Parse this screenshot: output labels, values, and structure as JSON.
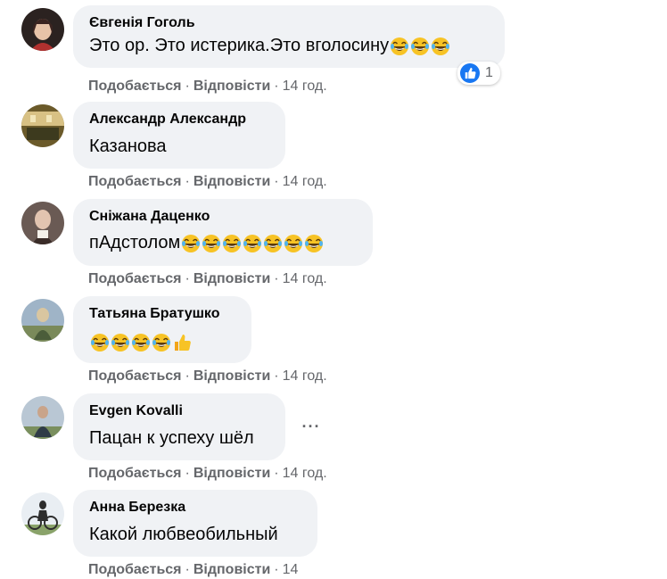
{
  "comments": [
    {
      "author": "Євгенія Гоголь",
      "text": "Это ор. Это истерика.Это вголосину",
      "emojis": [
        "laugh-cry",
        "laugh-cry",
        "laugh-cry"
      ],
      "like_label": "Подобається",
      "reply_label": "Відповісти",
      "time": "14 год.",
      "reaction_count": "1",
      "avatar_colors": [
        "#2b2220",
        "#b0312f",
        "#e7c3a8"
      ]
    },
    {
      "author": "Александр Александр",
      "text": "Казанова",
      "emojis": [],
      "like_label": "Подобається",
      "reply_label": "Відповісти",
      "time": "14 год.",
      "avatar_colors": [
        "#6b5a2a",
        "#d8c184",
        "#3d3a1e"
      ]
    },
    {
      "author": "Сніжана Даценко",
      "text": "пАдстолом",
      "emojis": [
        "laugh-cry",
        "laugh-cry",
        "laugh-cry",
        "laugh-cry",
        "laugh-cry",
        "laugh-cry",
        "laugh-cry"
      ],
      "like_label": "Подобається",
      "reply_label": "Відповісти",
      "time": "14 год.",
      "avatar_colors": [
        "#6a5a54",
        "#e2c4b0",
        "#3a2c28"
      ]
    },
    {
      "author": "Татьяна Братушко",
      "text": "",
      "emojis": [
        "laugh-cry",
        "laugh-cry",
        "laugh-cry",
        "laugh-cry",
        "thumbs-up"
      ],
      "like_label": "Подобається",
      "reply_label": "Відповісти",
      "time": "14 год.",
      "avatar_colors": [
        "#9fb4c7",
        "#4b5d3a",
        "#d9c6a0"
      ]
    },
    {
      "author": "Evgen Kovalli",
      "text": "Пацан к успеху шёл",
      "emojis": [],
      "like_label": "Подобається",
      "reply_label": "Відповісти",
      "time": "14 год.",
      "more_label": "···",
      "avatar_colors": [
        "#b9c7d4",
        "#2f3b47",
        "#7a8f5e"
      ]
    },
    {
      "author": "Анна Березка",
      "text": "Какой любвеобильный",
      "emojis": [],
      "like_label": "Подобається",
      "reply_label": "Відповісти",
      "time": "14",
      "avatar_colors": [
        "#e9eef3",
        "#2d2d2d",
        "#8aa36a"
      ]
    }
  ],
  "colors": {
    "bubble": "#f0f2f5",
    "secondary_text": "#65676b",
    "like_blue": "#1877f2"
  }
}
